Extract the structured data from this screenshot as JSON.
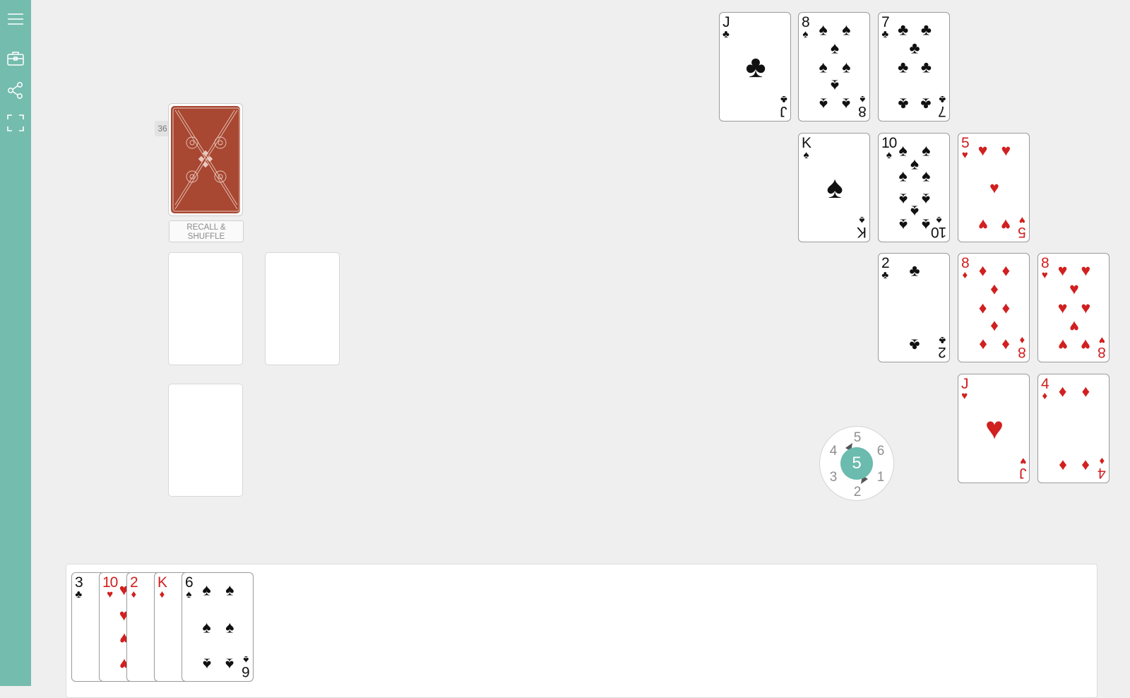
{
  "sidebar": {
    "menu_icon": "hamburger-icon",
    "toolbox_icon": "briefcase-icon",
    "share_icon": "share-icon",
    "fullscreen_icon": "fullscreen-icon"
  },
  "deck": {
    "count": "36",
    "recall_label": "RECALL & SHUFFLE",
    "back_color": "#a84732"
  },
  "dice": {
    "value": "5",
    "faces": [
      "5",
      "6",
      "1",
      "2",
      "3",
      "4"
    ],
    "accent": "#6bbbae"
  },
  "table_cards": [
    {
      "rank": "J",
      "suit": "♣"
    },
    {
      "rank": "8",
      "suit": "♠"
    },
    {
      "rank": "7",
      "suit": "♣"
    },
    {
      "rank": "K",
      "suit": "♠"
    },
    {
      "rank": "10",
      "suit": "♠"
    },
    {
      "rank": "5",
      "suit": "♥"
    },
    {
      "rank": "2",
      "suit": "♣"
    },
    {
      "rank": "8",
      "suit": "♦"
    },
    {
      "rank": "8",
      "suit": "♥"
    },
    {
      "rank": "J",
      "suit": "♥"
    },
    {
      "rank": "4",
      "suit": "♦"
    }
  ],
  "hand_cards": [
    {
      "rank": "3",
      "suit": "♣"
    },
    {
      "rank": "10",
      "suit": "♥"
    },
    {
      "rank": "2",
      "suit": "♦"
    },
    {
      "rank": "K",
      "suit": "♦"
    },
    {
      "rank": "6",
      "suit": "♠"
    }
  ],
  "colors": {
    "sidebar": "#74bcae",
    "red_suit": "#d0201f",
    "black_suit": "#111111"
  }
}
